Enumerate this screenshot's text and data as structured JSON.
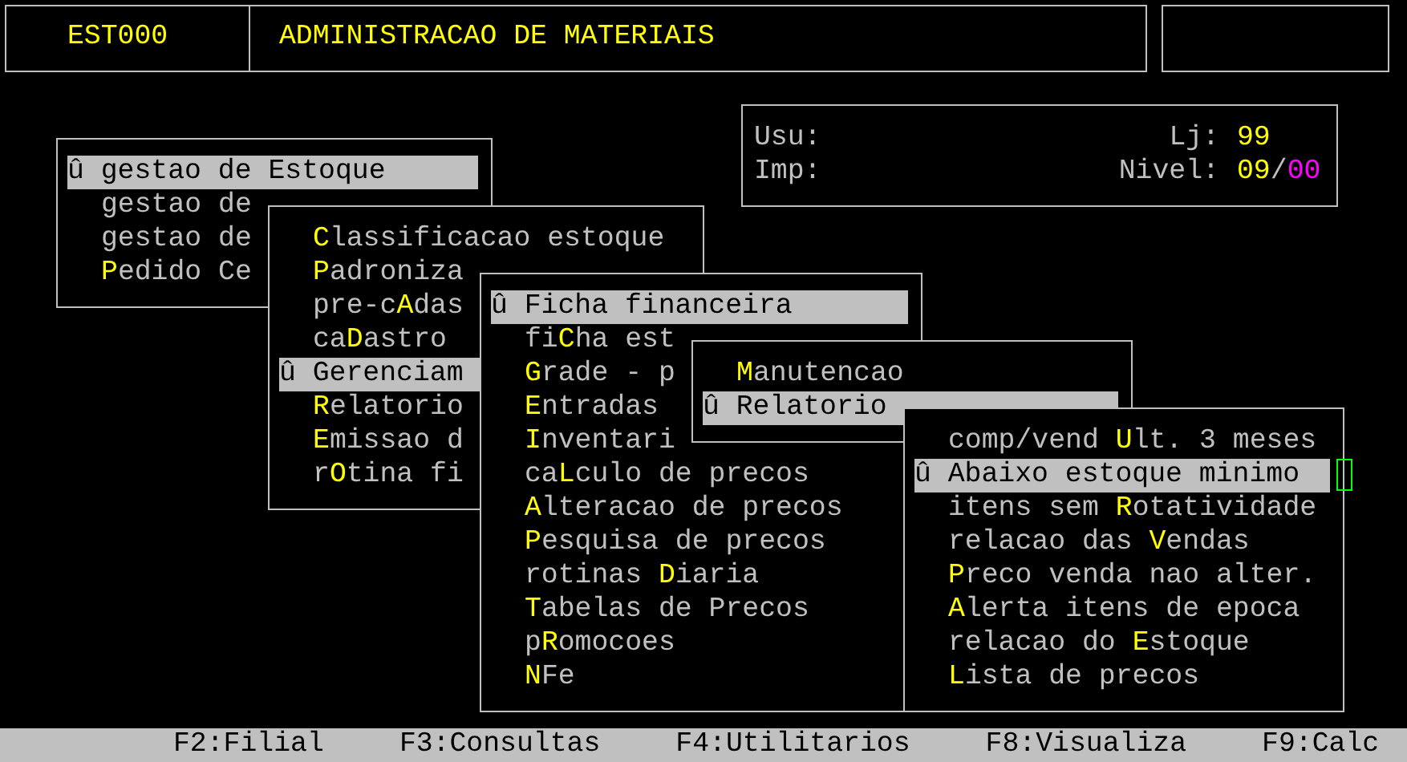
{
  "header": {
    "program_code": "EST000",
    "title": "ADMINISTRACAO DE MATERIAIS"
  },
  "info": {
    "user_label": "Usu:",
    "printer_label": "Imp:",
    "store_label": "Lj:",
    "store_value": "99",
    "level_label": "Nivel:",
    "level_value": "09",
    "level_separator": "/",
    "level_sub": "00"
  },
  "menus": [
    {
      "items": [
        {
          "label": "û gestao de Estoque",
          "selected": true
        },
        {
          "label": "gestao de",
          "selected": false
        },
        {
          "label": "gestao de",
          "selected": false
        },
        {
          "label": "**P**edido Ce",
          "selected": false
        }
      ]
    },
    {
      "items": [
        {
          "label": "**C**lassificacao estoque",
          "selected": false
        },
        {
          "label": "**P**adroniza",
          "selected": false
        },
        {
          "label": "pre-c**A**das",
          "selected": false
        },
        {
          "label": "ca**D**astro",
          "selected": false
        },
        {
          "label": "û Gerenciam",
          "selected": true
        },
        {
          "label": "**R**elatorio",
          "selected": false
        },
        {
          "label": "**E**missao d",
          "selected": false
        },
        {
          "label": "r**O**tina fi",
          "selected": false
        }
      ]
    },
    {
      "items": [
        {
          "label": "û Ficha financeira",
          "selected": true
        },
        {
          "label": "fi**C**ha est",
          "selected": false
        },
        {
          "label": "**G**rade - p",
          "selected": false
        },
        {
          "label": "**E**ntradas",
          "selected": false
        },
        {
          "label": "**I**nventari",
          "selected": false
        },
        {
          "label": "ca**L**culo de precos",
          "selected": false
        },
        {
          "label": "**A**lteracao de precos",
          "selected": false
        },
        {
          "label": "**P**esquisa de precos",
          "selected": false
        },
        {
          "label": "rotinas **D**iaria",
          "selected": false
        },
        {
          "label": "**T**abelas de Precos",
          "selected": false
        },
        {
          "label": "p**R**omocoes",
          "selected": false
        },
        {
          "label": "**N**Fe",
          "selected": false
        }
      ]
    },
    {
      "items": [
        {
          "label": "**M**anutencao",
          "selected": false
        },
        {
          "label": "û Relatorio",
          "selected": true
        }
      ]
    },
    {
      "items": [
        {
          "label": "comp/vend **U**lt. 3 meses",
          "selected": false
        },
        {
          "label": "û Abaixo estoque minimo",
          "selected": true
        },
        {
          "label": "itens sem **R**otatividade",
          "selected": false
        },
        {
          "label": "relacao das **V**endas",
          "selected": false
        },
        {
          "label": "**P**reco venda nao alter.",
          "selected": false
        },
        {
          "label": "**A**lerta itens de epoca",
          "selected": false
        },
        {
          "label": "relacao do **E**stoque",
          "selected": false
        },
        {
          "label": "**L**ista de precos",
          "selected": false
        }
      ]
    }
  ],
  "function_keys": [
    "F2:Filial",
    "F3:Consultas",
    "F4:Utilitarios",
    "F8:Visualiza",
    "F9:Calc"
  ]
}
